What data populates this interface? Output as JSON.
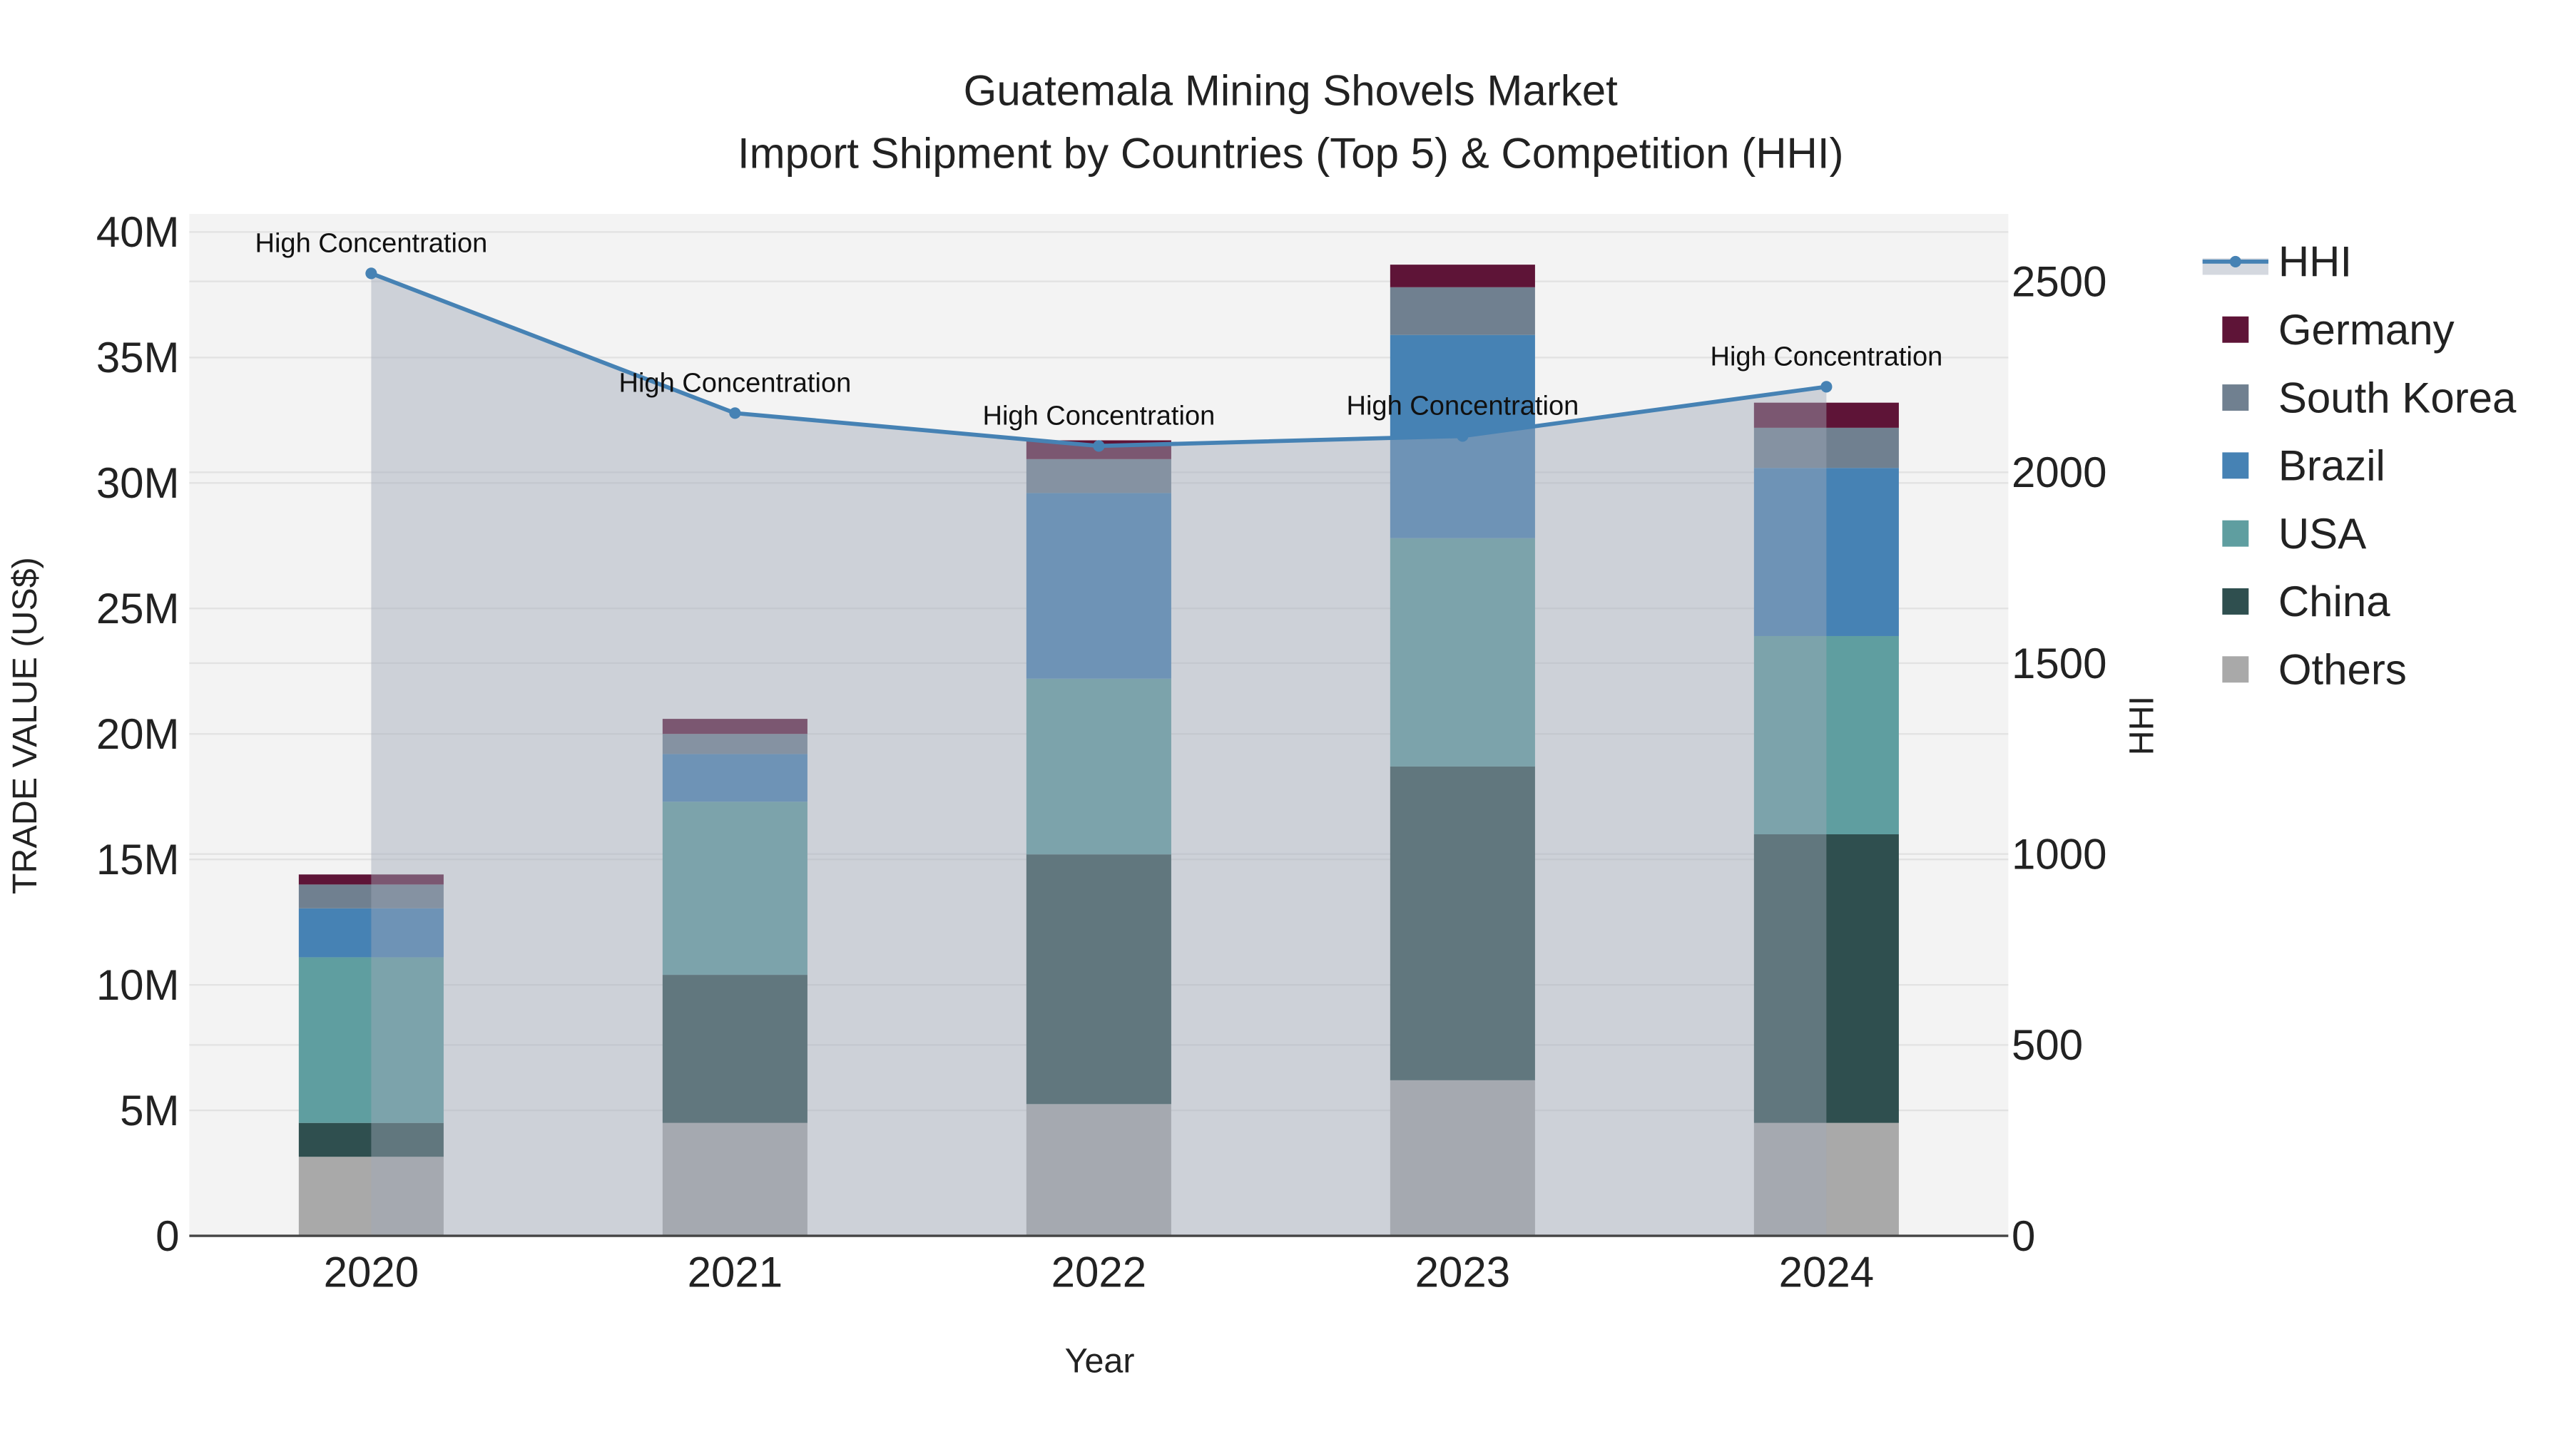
{
  "chart_data": {
    "type": "bar",
    "title_line1": "Guatemala Mining Shovels Market",
    "title_line2": "Import Shipment by Countries (Top 5) & Competition (HHI)",
    "xlabel": "Year",
    "ylabel": "TRADE VALUE (US$)",
    "y2label": "HHI",
    "categories": [
      "2020",
      "2021",
      "2022",
      "2023",
      "2024"
    ],
    "ylim": [
      0,
      40.7
    ],
    "y_ticks": [
      0,
      5,
      10,
      15,
      20,
      25,
      30,
      35,
      40
    ],
    "y_tick_labels": [
      "0",
      "5M",
      "10M",
      "15M",
      "20M",
      "25M",
      "30M",
      "35M",
      "40M"
    ],
    "y2lim": [
      0,
      2670
    ],
    "y2_ticks": [
      0,
      500,
      1000,
      1500,
      2000,
      2500
    ],
    "y2_tick_labels": [
      "0",
      "500",
      "1000",
      "1500",
      "2000",
      "2500"
    ],
    "units": "million US$",
    "series": [
      {
        "name": "Others",
        "color": "#a9a9a9",
        "values": [
          3.15,
          4.5,
          5.25,
          6.2,
          4.5
        ]
      },
      {
        "name": "China",
        "color": "#2f4f4f",
        "values": [
          1.35,
          5.9,
          9.95,
          12.5,
          11.5
        ]
      },
      {
        "name": "USA",
        "color": "#5f9ea0",
        "values": [
          6.6,
          6.9,
          7.0,
          9.1,
          7.9
        ]
      },
      {
        "name": "Brazil",
        "color": "#4682b4",
        "values": [
          1.95,
          1.9,
          7.4,
          8.1,
          6.7
        ]
      },
      {
        "name": "South Korea",
        "color": "#708090",
        "values": [
          0.95,
          0.8,
          1.35,
          1.9,
          1.6
        ]
      },
      {
        "name": "Germany",
        "color": "#5e1437",
        "values": [
          0.4,
          0.6,
          0.75,
          0.9,
          1.0
        ]
      }
    ],
    "hhi": {
      "name": "HHI",
      "color": "#4682b4",
      "values": [
        2521,
        2155,
        2069,
        2095,
        2224
      ],
      "annotations": [
        "High Concentration",
        "High Concentration",
        "High Concentration",
        "High Concentration",
        "High Concentration"
      ]
    },
    "legend_order": [
      "HHI",
      "Germany",
      "South Korea",
      "Brazil",
      "USA",
      "China",
      "Others"
    ],
    "legend_position": "right",
    "grid": true
  }
}
